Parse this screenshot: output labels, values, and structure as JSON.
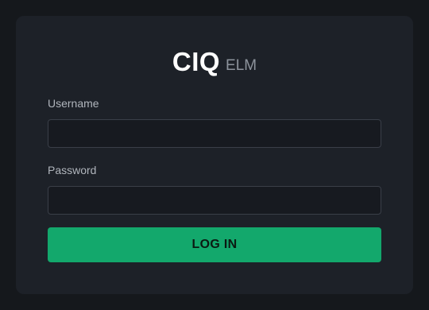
{
  "logo": {
    "main": "CIQ",
    "sub": "ELM"
  },
  "form": {
    "username_label": "Username",
    "username_value": "",
    "password_label": "Password",
    "password_value": "",
    "submit_label": "LOG IN"
  },
  "colors": {
    "background": "#15181c",
    "card": "#1d2128",
    "accent": "#13a86c"
  }
}
